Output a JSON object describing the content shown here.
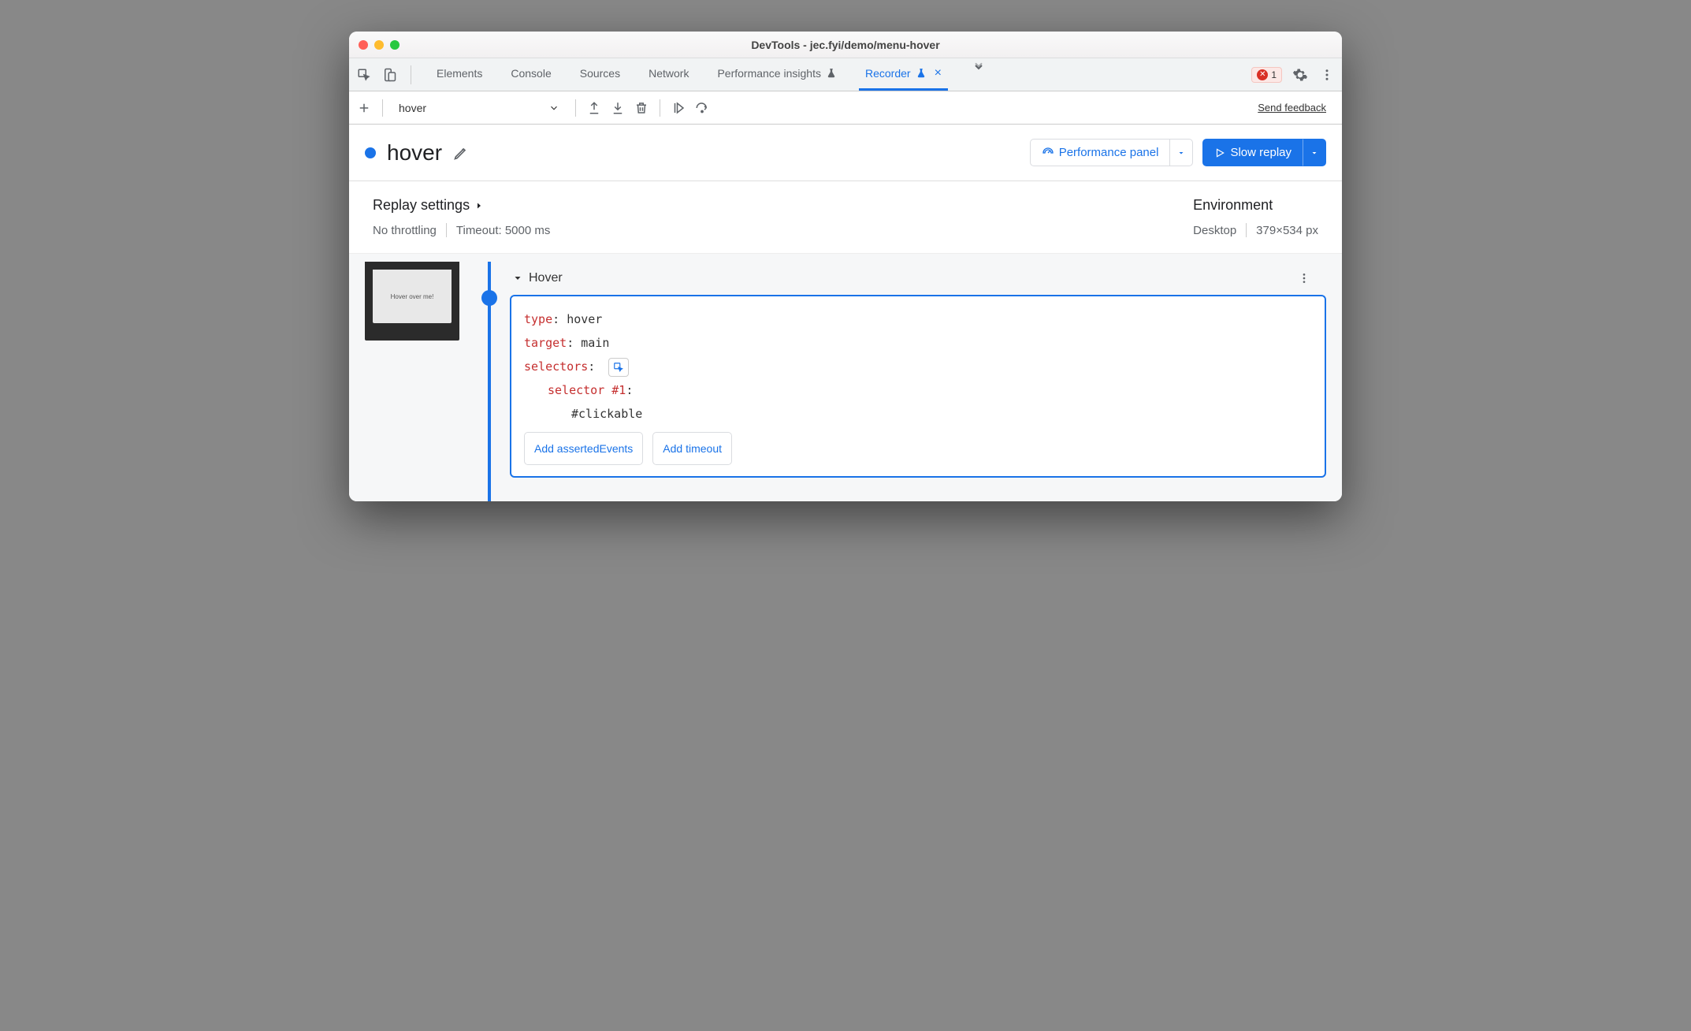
{
  "window": {
    "title": "DevTools - jec.fyi/demo/menu-hover"
  },
  "tabs": {
    "elements": "Elements",
    "console": "Console",
    "sources": "Sources",
    "network": "Network",
    "perf_insights": "Performance insights",
    "recorder": "Recorder"
  },
  "errors": {
    "count": "1"
  },
  "toolbar": {
    "recording_name": "hover",
    "feedback": "Send feedback"
  },
  "recording": {
    "title": "hover",
    "perf_panel_btn": "Performance panel",
    "slow_replay_btn": "Slow replay"
  },
  "settings": {
    "replay_label": "Replay settings",
    "throttling": "No throttling",
    "timeout": "Timeout: 5000 ms",
    "env_label": "Environment",
    "device": "Desktop",
    "dimensions": "379×534 px"
  },
  "thumbnail": {
    "text": "Hover over me!"
  },
  "step": {
    "name": "Hover",
    "type_key": "type",
    "type_val": "hover",
    "target_key": "target",
    "target_val": "main",
    "selectors_key": "selectors",
    "selector1_key": "selector #1",
    "selector1_val": "#clickable",
    "add_asserted": "Add assertedEvents",
    "add_timeout": "Add timeout"
  }
}
